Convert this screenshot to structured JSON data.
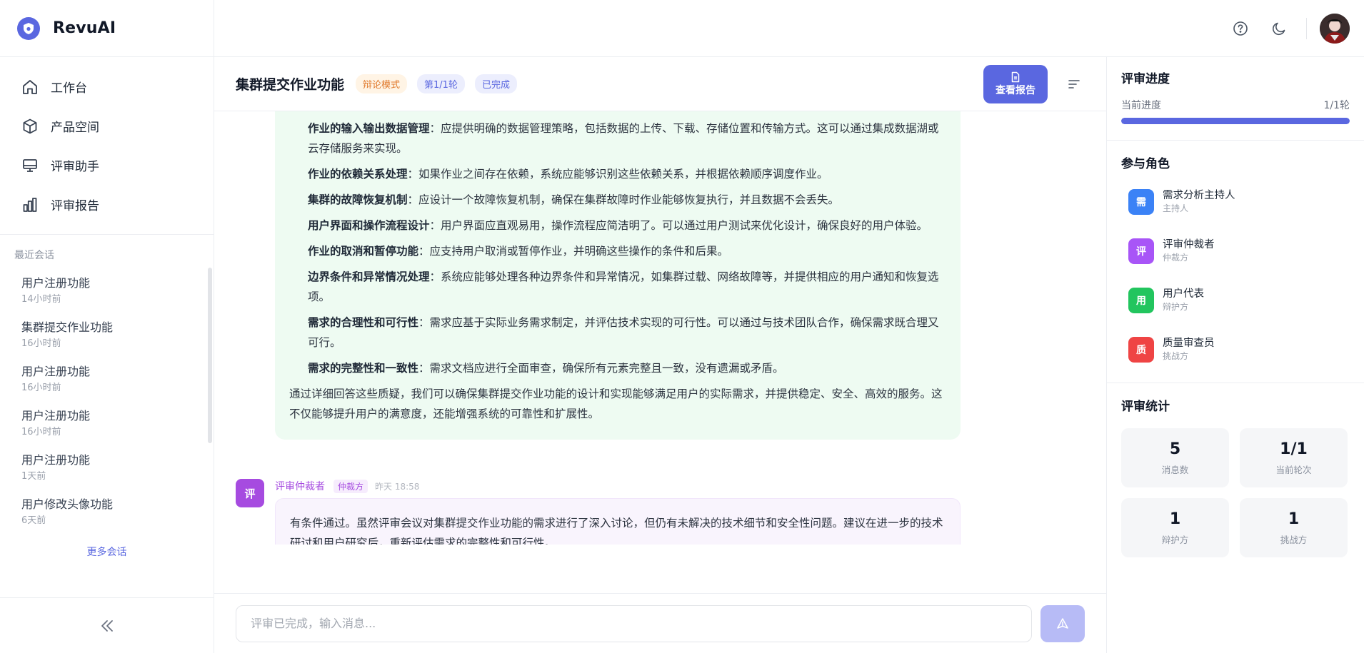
{
  "brand": {
    "name": "RevuAI"
  },
  "nav": [
    {
      "label": "工作台",
      "icon": "home-icon"
    },
    {
      "label": "产品空间",
      "icon": "cube-icon"
    },
    {
      "label": "评审助手",
      "icon": "monitor-icon"
    },
    {
      "label": "评审报告",
      "icon": "bar-chart-icon"
    }
  ],
  "recent": {
    "title": "最近会话",
    "items": [
      {
        "title": "用户注册功能",
        "time": "14小时前"
      },
      {
        "title": "集群提交作业功能",
        "time": "16小时前"
      },
      {
        "title": "用户注册功能",
        "time": "16小时前"
      },
      {
        "title": "用户注册功能",
        "time": "16小时前"
      },
      {
        "title": "用户注册功能",
        "time": "1天前"
      },
      {
        "title": "用户修改头像功能",
        "time": "6天前"
      }
    ],
    "more": "更多会话"
  },
  "conversation": {
    "title": "集群提交作业功能",
    "tags": {
      "mode": "辩论模式",
      "round": "第1/1轮",
      "status": "已完成"
    },
    "report_button": "查看报告"
  },
  "messages": {
    "points": [
      {
        "bold": "作业的输入输出数据管理",
        "text": "：应提供明确的数据管理策略，包括数据的上传、下载、存储位置和传输方式。这可以通过集成数据湖或云存储服务来实现。"
      },
      {
        "bold": "作业的依赖关系处理",
        "text": "：如果作业之间存在依赖，系统应能够识别这些依赖关系，并根据依赖顺序调度作业。"
      },
      {
        "bold": "集群的故障恢复机制",
        "text": "：应设计一个故障恢复机制，确保在集群故障时作业能够恢复执行，并且数据不会丢失。"
      },
      {
        "bold": "用户界面和操作流程设计",
        "text": "：用户界面应直观易用，操作流程应简洁明了。可以通过用户测试来优化设计，确保良好的用户体验。"
      },
      {
        "bold": "作业的取消和暂停功能",
        "text": "：应支持用户取消或暂停作业，并明确这些操作的条件和后果。"
      },
      {
        "bold": "边界条件和异常情况处理",
        "text": "：系统应能够处理各种边界条件和异常情况，如集群过载、网络故障等，并提供相应的用户通知和恢复选项。"
      },
      {
        "bold": "需求的合理性和可行性",
        "text": "：需求应基于实际业务需求制定，并评估技术实现的可行性。可以通过与技术团队合作，确保需求既合理又可行。"
      },
      {
        "bold": "需求的完整性和一致性",
        "text": "：需求文档应进行全面审查，确保所有元素完整且一致，没有遗漏或矛盾。"
      }
    ],
    "summary": "通过详细回答这些质疑，我们可以确保集群提交作业功能的设计和实现能够满足用户的实际需求，并提供稳定、安全、高效的服务。这不仅能够提升用户的满意度，还能增强系统的可靠性和扩展性。",
    "arbiter": {
      "avatar": "评",
      "name": "评审仲裁者",
      "role": "仲裁方",
      "time": "昨天 18:58",
      "text": "有条件通过。虽然评审会议对集群提交作业功能的需求进行了深入讨论，但仍有未解决的技术细节和安全性问题。建议在进一步的技术研讨和用户研究后，重新评估需求的完整性和可行性。"
    }
  },
  "composer": {
    "placeholder": "评审已完成，输入消息..."
  },
  "right_panel": {
    "progress": {
      "title": "评审进度",
      "label": "当前进度",
      "value": "1/1轮",
      "fraction": 1.0
    },
    "roles": {
      "title": "参与角色",
      "items": [
        {
          "avatar": "需",
          "name": "需求分析主持人",
          "role": "主持人",
          "color": "#3b82f6"
        },
        {
          "avatar": "评",
          "name": "评审仲裁者",
          "role": "仲裁方",
          "color": "#a855f7"
        },
        {
          "avatar": "用",
          "name": "用户代表",
          "role": "辩护方",
          "color": "#22c55e"
        },
        {
          "avatar": "质",
          "name": "质量审查员",
          "role": "挑战方",
          "color": "#ef4444"
        }
      ]
    },
    "stats": {
      "title": "评审统计",
      "items": [
        {
          "value": "5",
          "label": "消息数"
        },
        {
          "value": "1/1",
          "label": "当前轮次"
        },
        {
          "value": "1",
          "label": "辩护方"
        },
        {
          "value": "1",
          "label": "挑战方"
        }
      ]
    }
  },
  "colors": {
    "accent": "#5a67e0",
    "arbiter": "#a64be0",
    "debate_tag": "#e0782a"
  }
}
